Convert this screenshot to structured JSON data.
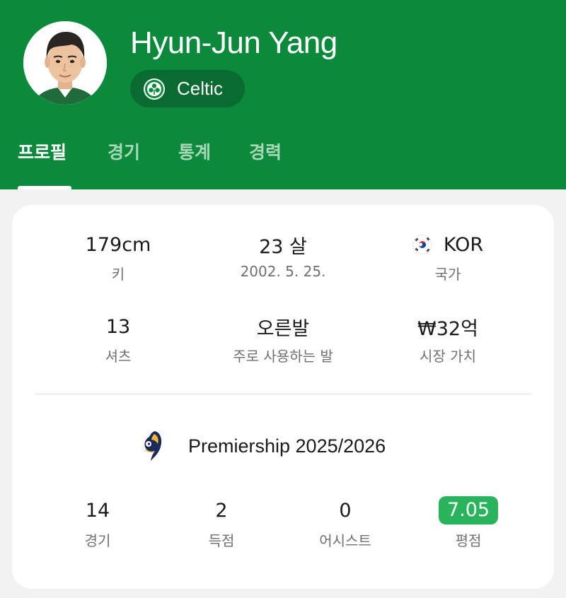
{
  "player": {
    "name": "Hyun-Jun Yang",
    "team": "Celtic"
  },
  "tabs": [
    {
      "label": "프로필",
      "active": true
    },
    {
      "label": "경기",
      "active": false
    },
    {
      "label": "통계",
      "active": false
    },
    {
      "label": "경력",
      "active": false
    }
  ],
  "profile": {
    "height": {
      "value": "179cm",
      "label": "키"
    },
    "age": {
      "value": "23 살",
      "label": "2002. 5. 25."
    },
    "country": {
      "value": "KOR",
      "label": "국가",
      "flag_icon": "south-korea-flag-icon"
    },
    "shirt": {
      "value": "13",
      "label": "셔츠"
    },
    "foot": {
      "value": "오른발",
      "label": "주로 사용하는 발"
    },
    "market_value": {
      "value": "₩32억",
      "label": "시장 가치"
    }
  },
  "season": {
    "league": "Premiership 2025/2026",
    "league_icon": "premiership-lion-logo",
    "stats": [
      {
        "value": "14",
        "label": "경기"
      },
      {
        "value": "2",
        "label": "득점"
      },
      {
        "value": "0",
        "label": "어시스트"
      },
      {
        "value": "7.05",
        "label": "평점"
      }
    ]
  },
  "colors": {
    "header_green": "#0b8a3c",
    "chip_green": "#0a6b30",
    "rating_green": "#29b35a"
  }
}
